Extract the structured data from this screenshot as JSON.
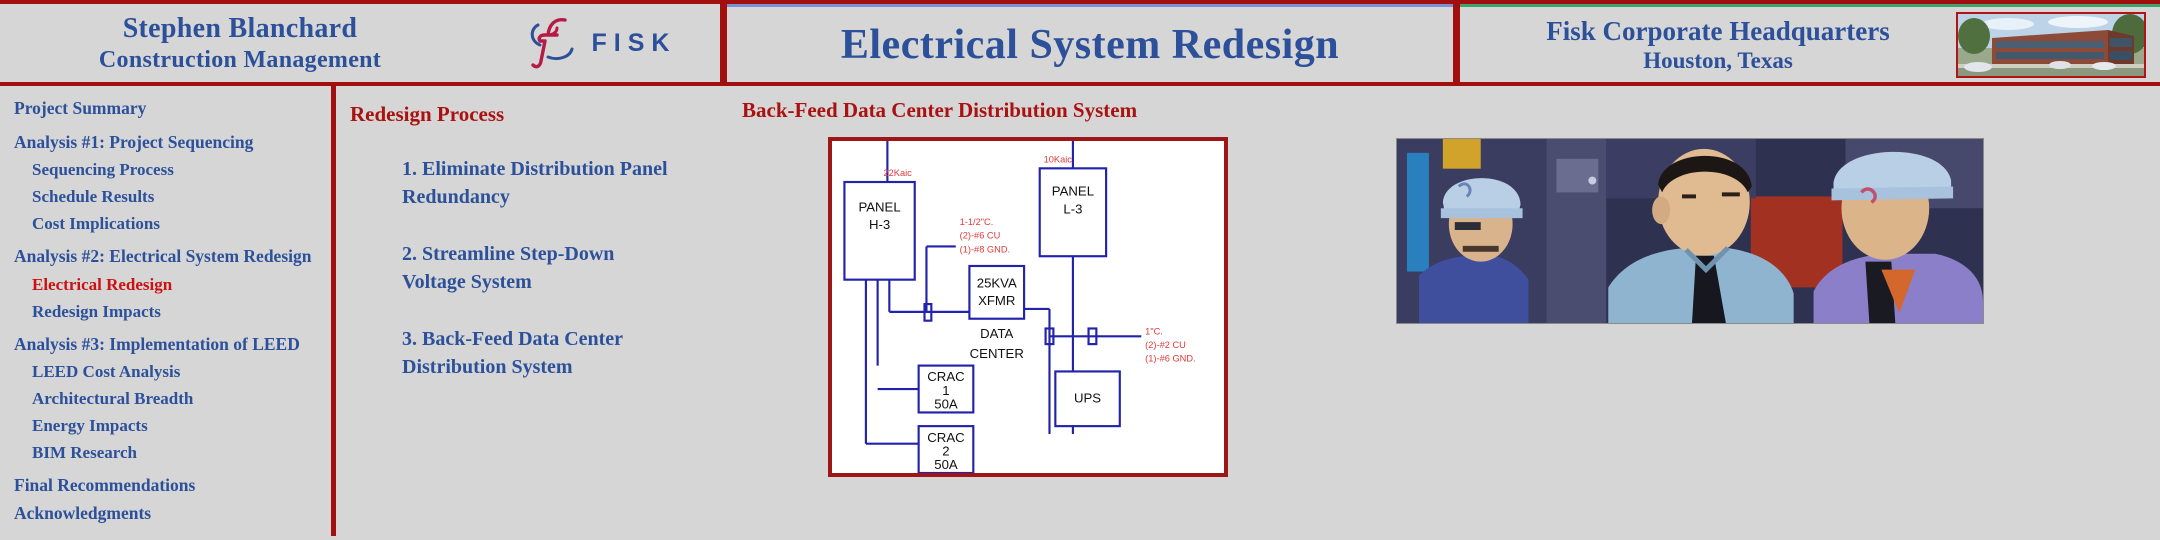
{
  "header": {
    "author_line1": "Stephen Blanchard",
    "author_line2": "Construction Management",
    "logo_word": "FISK",
    "logo_icon": "fisk-script-f-logo",
    "title": "Electrical System Redesign",
    "hq_line1": "Fisk Corporate Headquarters",
    "hq_line2": "Houston, Texas",
    "hq_image_alt": "fisk-corporate-headquarters-building-photo"
  },
  "sidebar": {
    "items": [
      {
        "label": "Project Summary",
        "level": 0,
        "active": false,
        "gap": false
      },
      {
        "label": "Analysis #1: Project Sequencing",
        "level": 0,
        "active": false,
        "gap": true
      },
      {
        "label": "Sequencing Process",
        "level": 1,
        "active": false,
        "gap": false
      },
      {
        "label": "Schedule Results",
        "level": 1,
        "active": false,
        "gap": false
      },
      {
        "label": "Cost Implications",
        "level": 1,
        "active": false,
        "gap": false
      },
      {
        "label": "Analysis #2: Electrical System Redesign",
        "level": 0,
        "active": false,
        "gap": true
      },
      {
        "label": "Electrical Redesign",
        "level": 1,
        "active": true,
        "gap": false
      },
      {
        "label": "Redesign Impacts",
        "level": 1,
        "active": false,
        "gap": false
      },
      {
        "label": "Analysis #3: Implementation of LEED",
        "level": 0,
        "active": false,
        "gap": true
      },
      {
        "label": "LEED Cost Analysis",
        "level": 1,
        "active": false,
        "gap": false
      },
      {
        "label": "Architectural Breadth",
        "level": 1,
        "active": false,
        "gap": false
      },
      {
        "label": "Energy Impacts",
        "level": 1,
        "active": false,
        "gap": false
      },
      {
        "label": "BIM Research",
        "level": 1,
        "active": false,
        "gap": false
      },
      {
        "label": "Final Recommendations",
        "level": 0,
        "active": false,
        "gap": true
      },
      {
        "label": "Acknowledgments",
        "level": 0,
        "active": false,
        "gap": false
      }
    ]
  },
  "process": {
    "heading": "Redesign Process",
    "steps": [
      "1. Eliminate Distribution Panel Redundancy",
      "2. Streamline Step-Down Voltage System",
      "3. Back-Feed Data Center Distribution System"
    ]
  },
  "diagram": {
    "heading": "Back-Feed Data Center Distribution System",
    "blocks": [
      {
        "id": "panel-h3",
        "label_1": "PANEL",
        "label_2": "H-3"
      },
      {
        "id": "panel-l3",
        "label_1": "PANEL",
        "label_2": "L-3"
      },
      {
        "id": "xfmr",
        "label_1": "25KVA",
        "label_2": "XFMR"
      },
      {
        "id": "crac-1",
        "label_1": "CRAC",
        "label_2": "1",
        "label_3": "50A"
      },
      {
        "id": "crac-2",
        "label_1": "CRAC",
        "label_2": "2",
        "label_3": "50A"
      },
      {
        "id": "ups",
        "label_1": "UPS"
      }
    ],
    "free_labels": [
      {
        "id": "data-center-line1",
        "text": "DATA"
      },
      {
        "id": "data-center-line2",
        "text": "CENTER"
      }
    ],
    "annotations": [
      {
        "id": "aic-h3",
        "text": "22Kaic"
      },
      {
        "id": "aic-l3",
        "text": "10Kaic"
      },
      {
        "id": "feeder-xfmr-1",
        "text": "1-1/2\"C."
      },
      {
        "id": "feeder-xfmr-2",
        "text": "(2)-#6  CU"
      },
      {
        "id": "feeder-xfmr-3",
        "text": "(1)-#8  GND."
      },
      {
        "id": "feeder-ups-1",
        "text": "1\"C."
      },
      {
        "id": "feeder-ups-2",
        "text": "(2)-#2  CU"
      },
      {
        "id": "feeder-ups-3",
        "text": "(1)-#6  GND."
      }
    ]
  },
  "photo": {
    "alt": "construction-workers-illustration"
  },
  "colors": {
    "accent_red": "#a10f0f",
    "heading_red": "#aa1111",
    "active_red": "#cc1111",
    "nav_blue": "#2c5099",
    "page_bg": "#d6d6d6",
    "wire_blue": "#2222aa",
    "annotation_red": "#e03a3a",
    "title_rule_blue": "#7b8fd4",
    "hq_rule_green": "#3fa36b"
  }
}
